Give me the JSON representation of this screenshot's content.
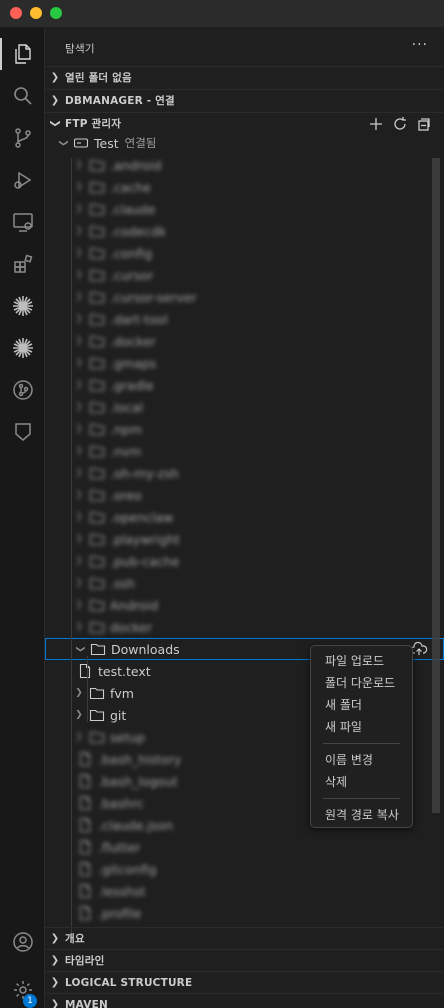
{
  "window": {
    "controls": [
      "close",
      "minimize",
      "maximize"
    ]
  },
  "activity_bar": {
    "items": [
      {
        "name": "explorer-icon",
        "active": true
      },
      {
        "name": "search-icon"
      },
      {
        "name": "source-control-icon"
      },
      {
        "name": "run-debug-icon"
      },
      {
        "name": "remote-explorer-icon"
      },
      {
        "name": "extensions-icon"
      },
      {
        "name": "burst-icon-1"
      },
      {
        "name": "burst-icon-2"
      },
      {
        "name": "git-graph-icon"
      },
      {
        "name": "shield-icon"
      }
    ],
    "bottom": [
      {
        "name": "account-icon"
      },
      {
        "name": "settings-gear-icon",
        "badge": "1"
      }
    ]
  },
  "sidebar": {
    "title": "탐색기",
    "more": "···",
    "sections": {
      "open_editors": "열린 폴더 없음",
      "dbmanager": "DBMANAGER - 연결",
      "ftp": "FTP 관리자",
      "outline": "개요",
      "timeline": "타임라인",
      "logical": "LOGICAL STRUCTURE",
      "maven": "MAVEN"
    }
  },
  "tree": {
    "connection": {
      "label": "Test",
      "status": "연결됨"
    },
    "blurred_folders": [
      ".android",
      ".cache",
      ".claude",
      ".codecdk",
      ".config",
      ".cursor",
      ".cursor-server",
      ".dart-tool",
      ".docker",
      ".gmaps",
      ".gradle",
      ".local",
      ".npm",
      ".nvm",
      ".oh-my-zsh",
      ".oreo",
      ".openclaw",
      ".playwright",
      ".pub-cache",
      ".ssh",
      "Android",
      "docker"
    ],
    "downloads": "Downloads",
    "downloads_children": [
      {
        "type": "file",
        "label": "test.text"
      },
      {
        "type": "folder",
        "label": "fvm"
      },
      {
        "type": "folder",
        "label": "git"
      }
    ],
    "blurred_after": [
      {
        "type": "folder",
        "label": "setup"
      },
      {
        "type": "file",
        "label": ".bash_history"
      },
      {
        "type": "file",
        "label": ".bash_logout"
      },
      {
        "type": "file",
        "label": ".bashrc"
      },
      {
        "type": "file",
        "label": ".claude.json"
      },
      {
        "type": "file",
        "label": ".flutter"
      },
      {
        "type": "file",
        "label": ".gitconfig"
      },
      {
        "type": "file",
        "label": ".lesshst"
      },
      {
        "type": "file",
        "label": ".profile"
      }
    ]
  },
  "context_menu": {
    "upload": "파일 업로드",
    "download": "폴더 다운로드",
    "new_folder": "새 폴더",
    "new_file": "새 파일",
    "rename": "이름 변경",
    "delete": "삭제",
    "copy_path": "원격 경로 복사"
  },
  "colors": {
    "accent": "#0078d4",
    "background": "#1f1f1f",
    "activity": "#181818"
  }
}
